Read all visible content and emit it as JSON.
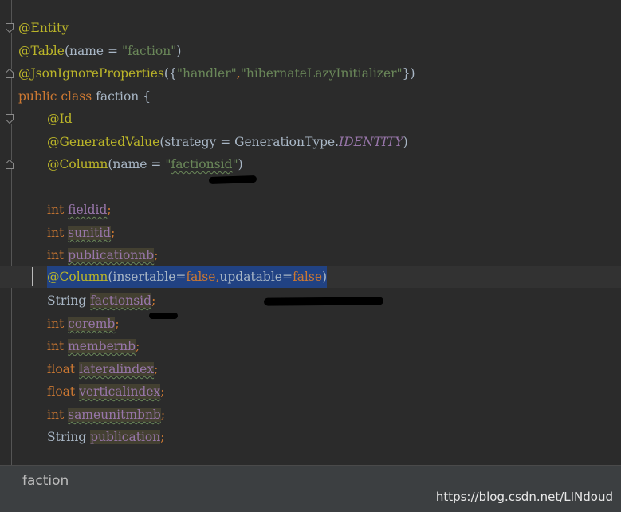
{
  "editor": {
    "lines": {
      "l1": {
        "ann": "@Entity"
      },
      "l2": {
        "ann": "@Table",
        "open": "(",
        "attr": "name = ",
        "str": "\"faction\"",
        "close": ")"
      },
      "l3": {
        "ann": "@JsonIgnoreProperties",
        "open": "({",
        "str1": "\"handler\"",
        "comma": ",",
        "str2": "\"hibernateLazyInitializer\"",
        "close": "})"
      },
      "l4": {
        "kw1": "public",
        "kw2": "class",
        "name": "faction",
        "brace": "{"
      },
      "l5": {
        "ann": "@Id"
      },
      "l6": {
        "ann": "@GeneratedValue",
        "open": "(",
        "attr": "strategy = GenerationType.",
        "const": "IDENTITY",
        "close": ")"
      },
      "l7": {
        "ann": "@Column",
        "open": "(",
        "attr": "name = ",
        "q1": "\"",
        "val": "factionsid",
        "q2": "\"",
        "close": ")"
      },
      "l9": {
        "type": "int",
        "field": "fieldid",
        "semi": ";"
      },
      "l10": {
        "type": "int",
        "field": "sunitid",
        "semi": ";"
      },
      "l11": {
        "type": "int",
        "field": "publicationnb",
        "semi": ";"
      },
      "l12": {
        "ann": "@Column",
        "open": "(",
        "a1": "insertable=",
        "v1": "false",
        "comma": ",",
        "a2": "updatable=",
        "v2": "false",
        "close": ")"
      },
      "l13": {
        "type": "String",
        "field": "factionsid",
        "semi": ";"
      },
      "l14": {
        "type": "int",
        "field": "coremb",
        "semi": ";"
      },
      "l15": {
        "type": "int",
        "field": "membernb",
        "semi": ";"
      },
      "l16": {
        "type": "float",
        "field": "lateralindex",
        "semi": ";"
      },
      "l17": {
        "type": "float",
        "field": "verticalindex",
        "semi": ";"
      },
      "l18": {
        "type": "int",
        "field": "sameunitmbnb",
        "semi": ";"
      },
      "l19": {
        "type": "String",
        "field": "publication",
        "semi": ";"
      }
    }
  },
  "footer": {
    "breadcrumb": "faction",
    "watermark": "https://blog.csdn.net/LINdoud"
  },
  "colors": {
    "background": "#2b2b2b",
    "annotation": "#bbb529",
    "keyword": "#cc7832",
    "string": "#6a8759",
    "field": "#9876aa",
    "selection": "#214283"
  }
}
